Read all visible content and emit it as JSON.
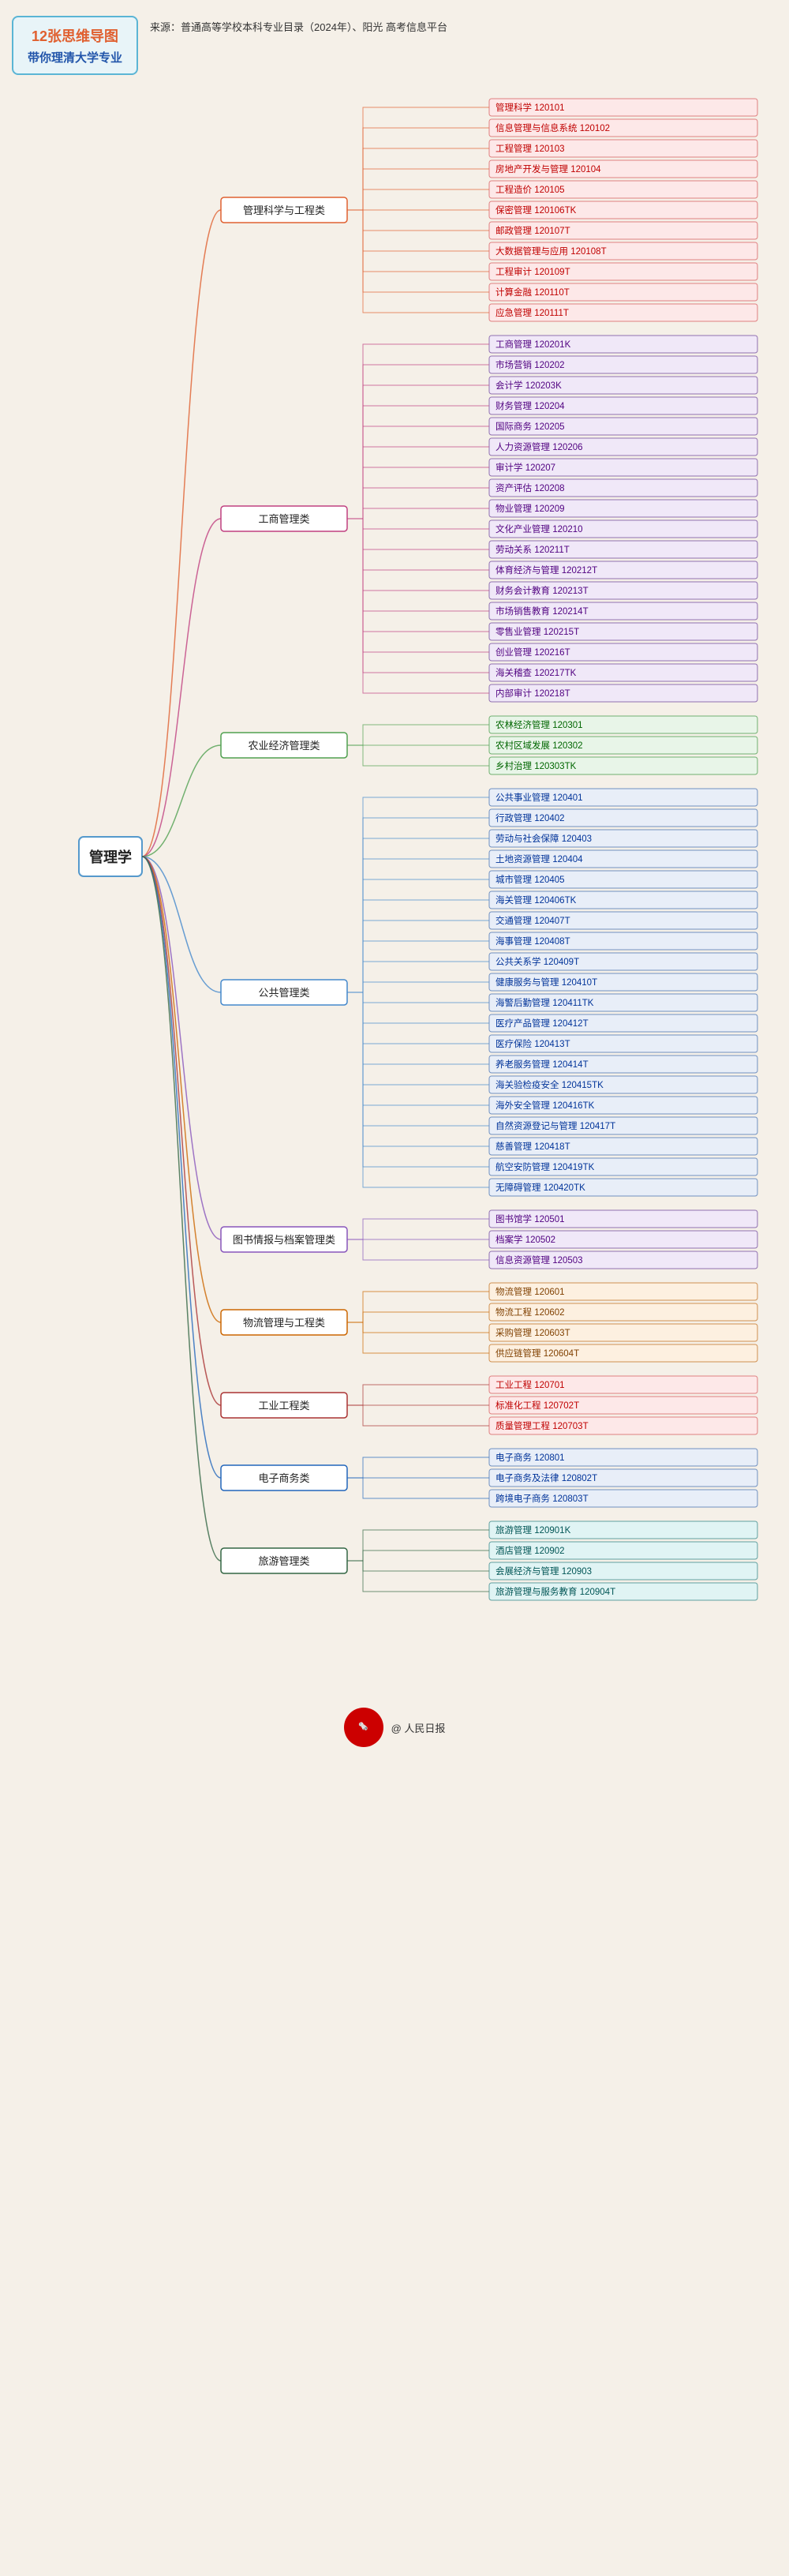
{
  "header": {
    "title_line1": "12张思维导图",
    "title_line2": "带你理清大学专业",
    "source": "来源：普通高等学校本科专业目录（2024年）、阳光\n高考信息平台"
  },
  "central": {
    "label": "管理学"
  },
  "categories": [
    {
      "id": "cat1",
      "label": "管理科学与工程类",
      "color": "#e06030",
      "leaves": [
        "管理科学 120101",
        "信息管理与信息系统 120102",
        "工程管理 120103",
        "房地产开发与管理 120104",
        "工程造价 120105",
        "保密管理 120106TK",
        "邮政管理 120107T",
        "大数据管理与应用 120108T",
        "工程审计 120109T",
        "计算金融 120110T",
        "应急管理 120111T"
      ],
      "leafColor": "red"
    },
    {
      "id": "cat2",
      "label": "工商管理类",
      "color": "#c04080",
      "leaves": [
        "工商管理 120201K",
        "市场营销 120202",
        "会计学 120203K",
        "财务管理 120204",
        "国际商务 120205",
        "人力资源管理 120206",
        "审计学 120207",
        "资产评估 120208",
        "物业管理 120209",
        "文化产业管理 120210",
        "劳动关系 120211T",
        "体育经济与管理 120212T",
        "财务会计教育 120213T",
        "市场销售教育 120214T",
        "零售业管理 120215T",
        "创业管理 120216T",
        "海关稽查 120217TK",
        "内部审计 120218T"
      ],
      "leafColor": "purple"
    },
    {
      "id": "cat3",
      "label": "农业经济管理类",
      "color": "#50a050",
      "leaves": [
        "农林经济管理 120301",
        "农村区域发展 120302",
        "乡村治理 120303TK"
      ],
      "leafColor": "green"
    },
    {
      "id": "cat4",
      "label": "公共管理类",
      "color": "#4488cc",
      "leaves": [
        "公共事业管理 120401",
        "行政管理 120402",
        "劳动与社会保障 120403",
        "土地资源管理 120404",
        "城市管理 120405",
        "海关管理 120406TK",
        "交通管理 120407T",
        "海事管理 120408T",
        "公共关系学 120409T",
        "健康服务与管理 120410T",
        "海警后勤管理 120411TK",
        "医疗产品管理 120412T",
        "医疗保险 120413T",
        "养老服务管理 120414T",
        "海关验检疫安全 120415TK",
        "海外安全管理 120416TK",
        "自然资源登记与管理 120417T",
        "慈善管理 120418T",
        "航空安防管理 120419TK",
        "无障碍管理 120420TK"
      ],
      "leafColor": "blue"
    },
    {
      "id": "cat5",
      "label": "图书情报与档案管理类",
      "color": "#8855bb",
      "leaves": [
        "图书馆学 120501",
        "档案学 120502",
        "信息资源管理 120503"
      ],
      "leafColor": "purple"
    },
    {
      "id": "cat6",
      "label": "物流管理与工程类",
      "color": "#cc6600",
      "leaves": [
        "物流管理 120601",
        "物流工程 120602",
        "采购管理 120603T",
        "供应链管理 120604T"
      ],
      "leafColor": "orange"
    },
    {
      "id": "cat7",
      "label": "工业工程类",
      "color": "#aa3333",
      "leaves": [
        "工业工程 120701",
        "标准化工程 120702T",
        "质量管理工程 120703T"
      ],
      "leafColor": "red"
    },
    {
      "id": "cat8",
      "label": "电子商务类",
      "color": "#2266bb",
      "leaves": [
        "电子商务 120801",
        "电子商务及法律 120802T",
        "跨境电子商务 120803T"
      ],
      "leafColor": "blue"
    },
    {
      "id": "cat9",
      "label": "旅游管理类",
      "color": "#336644",
      "leaves": [
        "旅游管理 120901K",
        "酒店管理 120902",
        "会展经济与管理 120903",
        "旅游管理与服务教育 120904T"
      ],
      "leafColor": "teal"
    }
  ],
  "footer": {
    "logo_text": "人民日报",
    "watermark": "@ 人民日报"
  }
}
